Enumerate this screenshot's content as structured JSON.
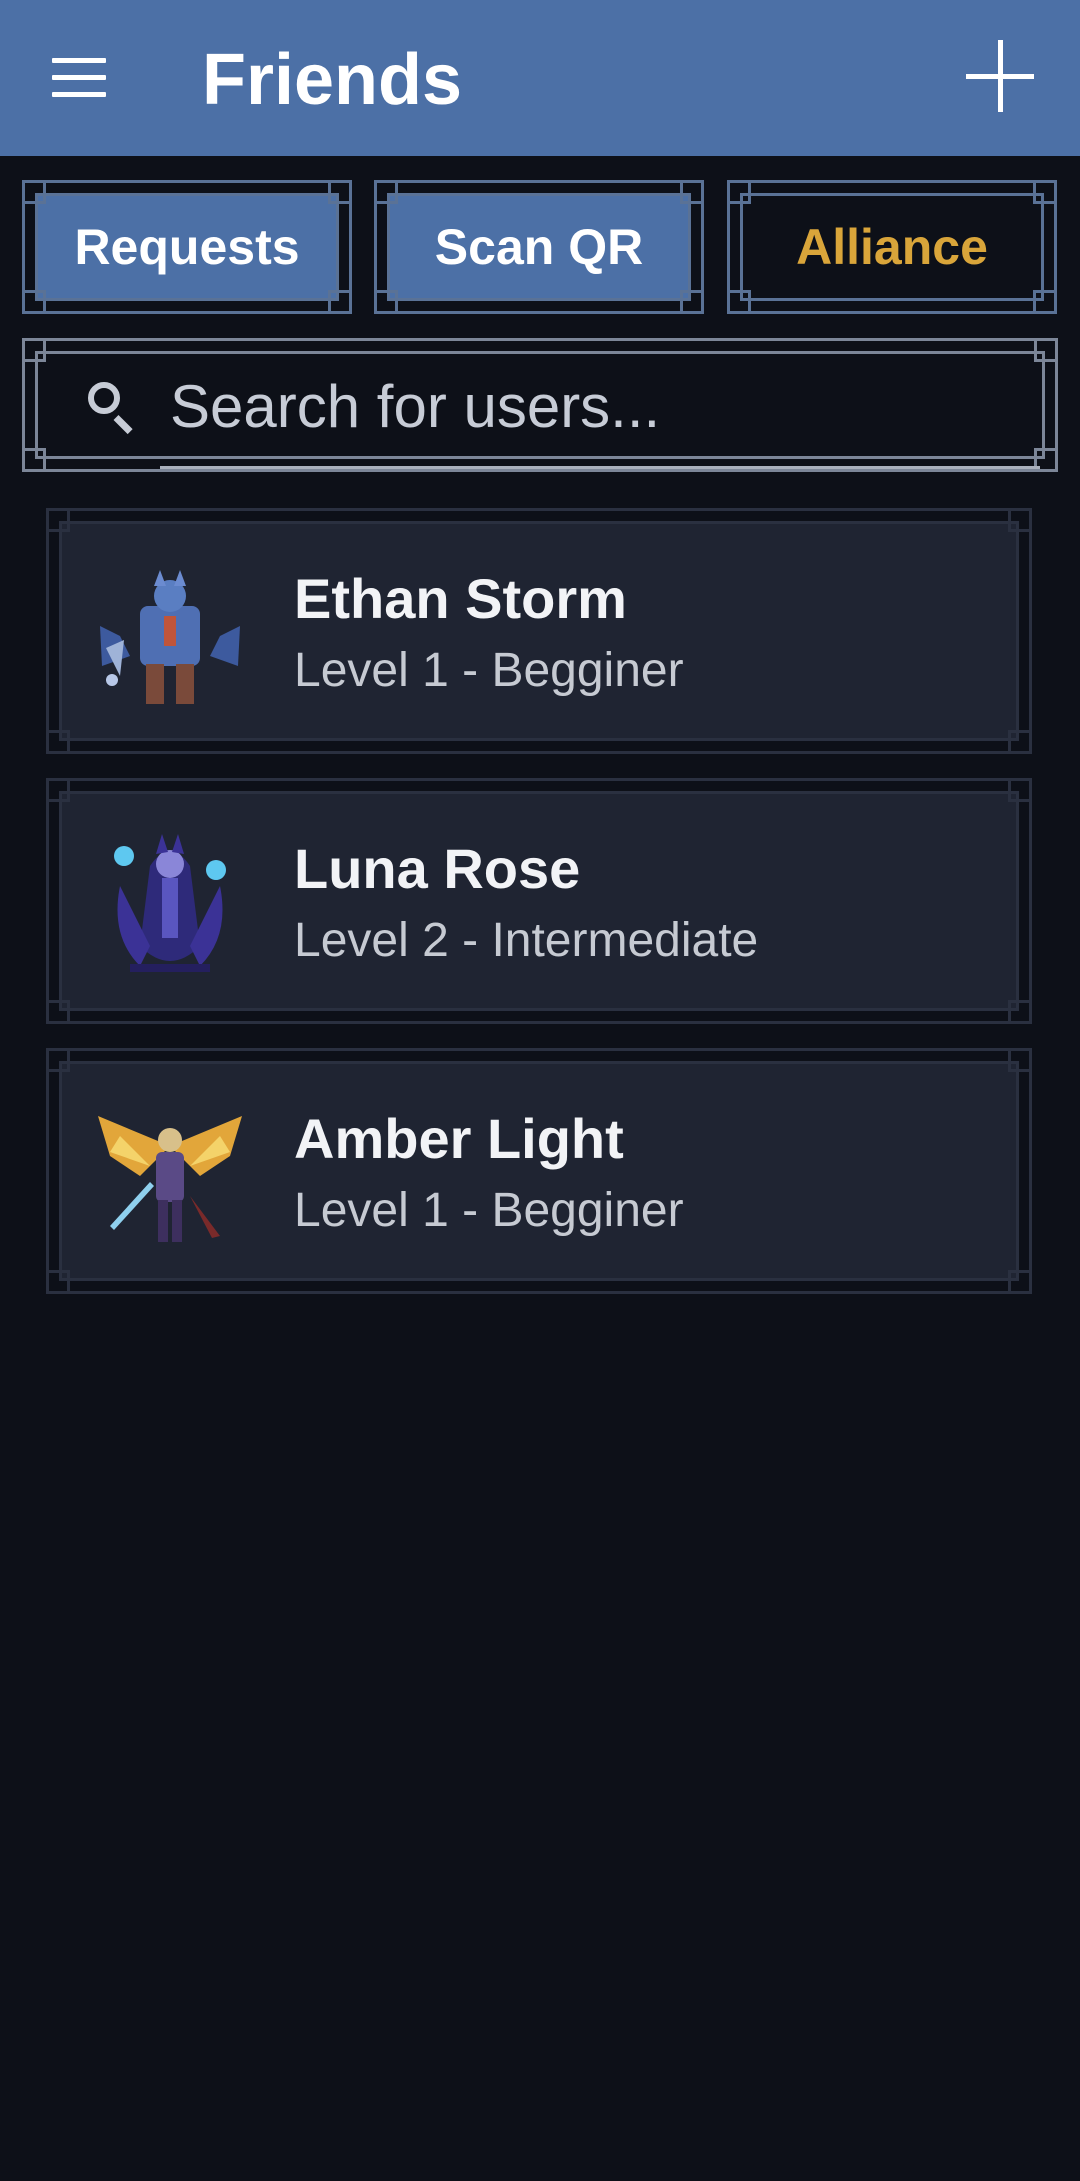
{
  "appbar": {
    "title": "Friends",
    "menu_icon": "menu-icon",
    "add_icon": "add-icon"
  },
  "tabs": [
    {
      "label": "Requests",
      "style": "blue"
    },
    {
      "label": "Scan QR",
      "style": "blue"
    },
    {
      "label": "Alliance",
      "style": "dark",
      "color": "#d9a53a"
    }
  ],
  "search": {
    "placeholder": "Search for users...",
    "value": ""
  },
  "friends": [
    {
      "name": "Ethan Storm",
      "level": "Level 1 - Begginer",
      "avatar": "armored-knight-avatar"
    },
    {
      "name": "Luna Rose",
      "level": "Level 2 - Intermediate",
      "avatar": "sorceress-avatar"
    },
    {
      "name": "Amber Light",
      "level": "Level 1 - Begginer",
      "avatar": "winged-valkyrie-avatar"
    }
  ],
  "colors": {
    "appbar": "#4c70a6",
    "background": "#0d1018",
    "card": "#1f2432",
    "accent": "#d9a53a"
  }
}
